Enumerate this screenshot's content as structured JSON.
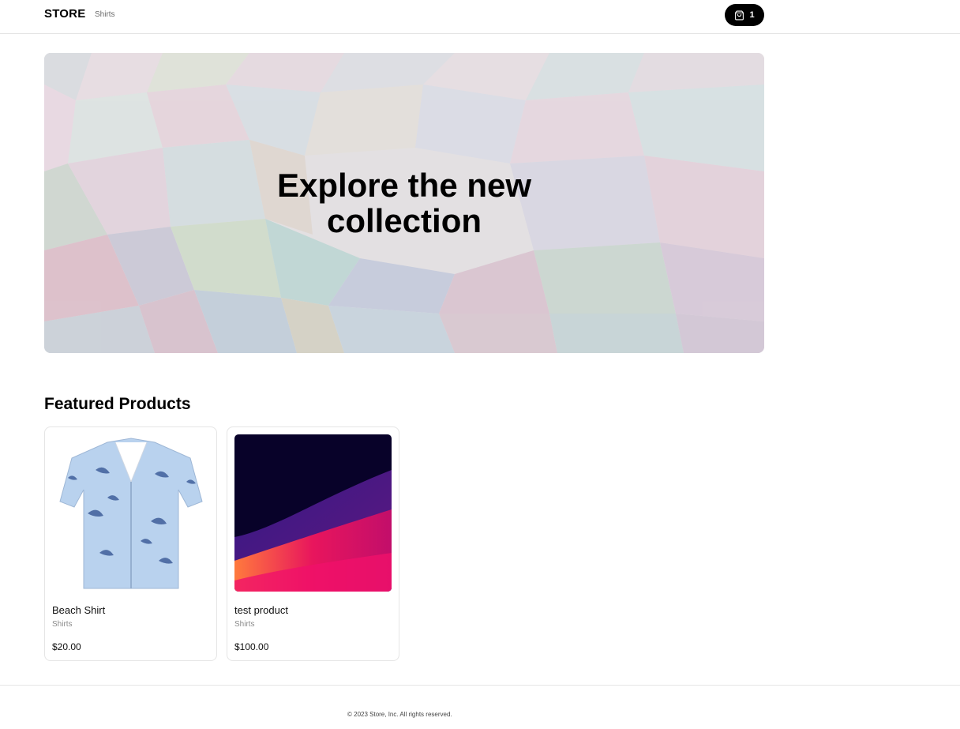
{
  "nav": {
    "brand": "STORE",
    "links": [
      "Shirts"
    ],
    "cart_count": "1",
    "cart_icon": "shopping-bag-icon"
  },
  "hero": {
    "title": "Explore the new collection"
  },
  "featured": {
    "title": "Featured Products",
    "products": [
      {
        "name": "Beach Shirt",
        "category": "Shirts",
        "price": "$20.00"
      },
      {
        "name": "test product",
        "category": "Shirts",
        "price": "$100.00"
      }
    ]
  },
  "footer": {
    "text": "© 2023 Store, Inc. All rights reserved."
  },
  "colors": {
    "cart_bg": "#000000",
    "border": "#e5e5e5",
    "muted_text": "#8a8a8a"
  }
}
